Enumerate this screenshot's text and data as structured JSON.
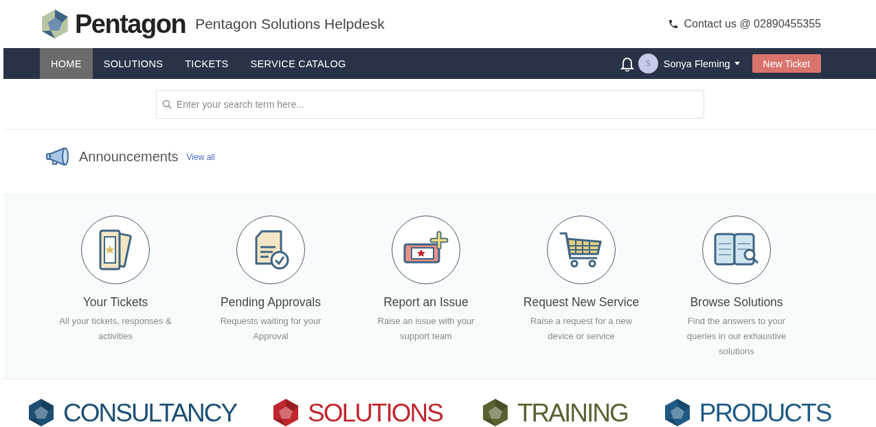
{
  "header": {
    "logo_text": "Pentagon",
    "title": "Pentagon Solutions Helpdesk",
    "contact": "Contact us @ 02890455355"
  },
  "nav": {
    "items": [
      {
        "label": "HOME",
        "selected": true
      },
      {
        "label": "SOLUTIONS",
        "selected": false
      },
      {
        "label": "TICKETS",
        "selected": false
      },
      {
        "label": "SERVICE CATALOG",
        "selected": false
      }
    ],
    "user": {
      "initial": "S",
      "name": "Sonya Fleming"
    },
    "new_ticket": "New Ticket"
  },
  "search": {
    "placeholder": "Enter your search term here..."
  },
  "announcements": {
    "title": "Announcements",
    "link": "View all"
  },
  "cards": [
    {
      "kind": "tickets",
      "title": "Your Tickets",
      "description": "All your tickets, responses & activities"
    },
    {
      "kind": "approvals",
      "title": "Pending Approvals",
      "description": "Requests waiting for your Approval"
    },
    {
      "kind": "issue",
      "title": "Report an Issue",
      "description": "Raise an issue with your support team"
    },
    {
      "kind": "service",
      "title": "Request New Service",
      "description": "Raise a request for a new device or service"
    },
    {
      "kind": "solutions",
      "title": "Browse Solutions",
      "description": "Find the answers to your queries in our exhaustive solutions"
    }
  ],
  "brands": [
    {
      "label": "CONSULTANCY",
      "color": "#1c4f73"
    },
    {
      "label": "SOLUTIONS",
      "color": "#c0262d"
    },
    {
      "label": "TRAINING",
      "color": "#5c6132"
    },
    {
      "label": "PRODUCTS",
      "color": "#1f5a85"
    }
  ]
}
